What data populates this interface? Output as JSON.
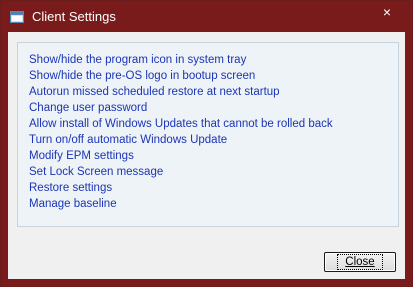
{
  "window": {
    "title": "Client Settings",
    "close_glyph": "×",
    "title_icon": "settings-window-icon"
  },
  "colors": {
    "titlebar": "#7a1b1b",
    "link": "#1b35b5",
    "panel": "#eef3f7"
  },
  "settings_links": [
    "Show/hide the program icon in system tray",
    "Show/hide the pre-OS logo in bootup screen",
    "Autorun missed scheduled restore at next startup",
    "Change user password",
    "Allow install of Windows Updates that cannot be rolled back",
    "Turn on/off automatic Windows Update",
    "Modify EPM settings",
    "Set Lock Screen message",
    "Restore settings",
    "Manage baseline"
  ],
  "footer": {
    "close_label": "Close"
  }
}
